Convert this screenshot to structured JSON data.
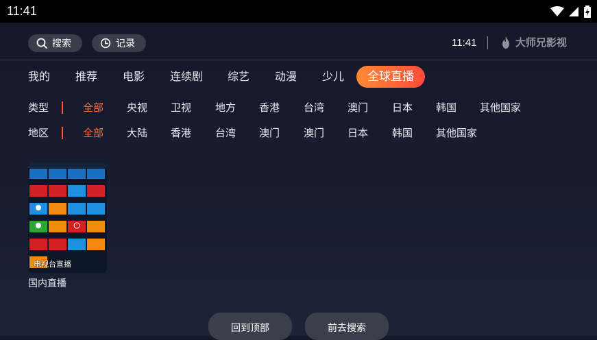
{
  "status_bar": {
    "time": "11:41"
  },
  "header": {
    "search_label": "搜索",
    "history_label": "记录",
    "clock": "11:41",
    "brand_name": "大师兄影视"
  },
  "nav": {
    "tabs": [
      {
        "label": "我的",
        "active": false
      },
      {
        "label": "推荐",
        "active": false
      },
      {
        "label": "电影",
        "active": false
      },
      {
        "label": "连续剧",
        "active": false
      },
      {
        "label": "综艺",
        "active": false
      },
      {
        "label": "动漫",
        "active": false
      },
      {
        "label": "少儿",
        "active": false
      },
      {
        "label": "全球直播",
        "active": true
      }
    ]
  },
  "filters": {
    "type": {
      "label": "类型",
      "options": [
        "全部",
        "央视",
        "卫视",
        "地方",
        "香港",
        "台湾",
        "澳门",
        "日本",
        "韩国",
        "其他国家"
      ],
      "selected": "全部"
    },
    "region": {
      "label": "地区",
      "options": [
        "全部",
        "大陆",
        "香港",
        "台湾",
        "澳门",
        "澳门",
        "日本",
        "韩国",
        "其他国家"
      ],
      "selected": "全部"
    }
  },
  "content": {
    "cards": [
      {
        "caption": "电视台直播",
        "title": "国内直播"
      }
    ]
  },
  "footer": {
    "back_to_top": "回到顶部",
    "go_search": "前去搜索"
  },
  "colors": {
    "accent": "#ff5a36",
    "accent_gradient_start": "#ff8a35",
    "background": "#161a2b",
    "button_bg": "#3a3e4a"
  }
}
